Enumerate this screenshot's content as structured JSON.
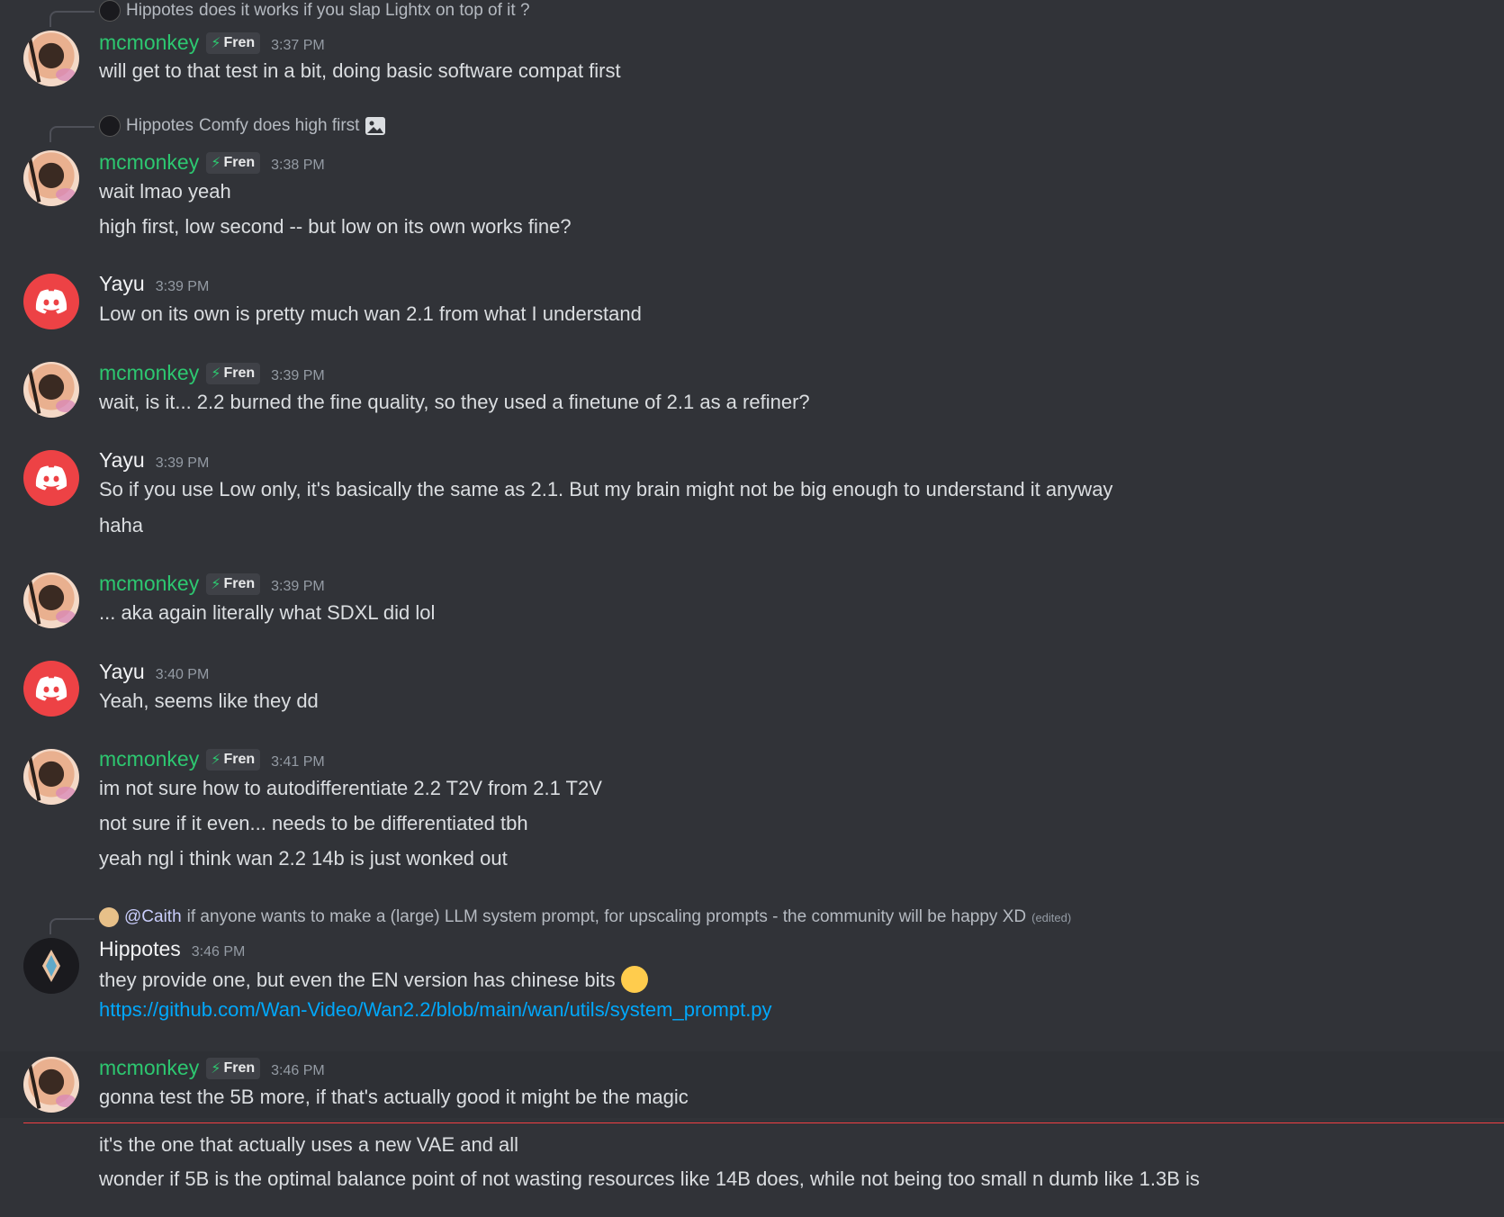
{
  "users": {
    "mcmonkey": {
      "name": "mcmonkey",
      "tag": "Fren"
    },
    "yayu": {
      "name": "Yayu"
    },
    "hippotes": {
      "name": "Hippotes"
    }
  },
  "colors": {
    "mcmonkey_name": "#2dc770",
    "link": "#00a8fc",
    "new_divider": "#f23f43"
  },
  "messages": [
    {
      "reply_user": "Hippotes",
      "reply_text": "does it works if you slap Lightx on top of it ?",
      "time": "3:37 PM",
      "lines": [
        "will get to that test in a bit, doing basic software compat first"
      ]
    },
    {
      "reply_user": "Hippotes",
      "reply_text": "Comfy does high first",
      "reply_icon": "image-icon",
      "time": "3:38 PM",
      "lines": [
        "wait lmao yeah",
        "high first, low second -- but low on its own works fine?"
      ]
    },
    {
      "time": "3:39 PM",
      "lines": [
        "Low on its own is pretty much wan 2.1 from what I understand"
      ]
    },
    {
      "time": "3:39 PM",
      "lines": [
        "wait, is it... 2.2 burned the fine quality, so they used a finetune of 2.1 as a refiner?"
      ]
    },
    {
      "time": "3:39 PM",
      "lines": [
        "So if you use Low only, it's basically the same as 2.1. But my brain might not be big enough to understand it anyway",
        "haha"
      ]
    },
    {
      "time": "3:39 PM",
      "lines": [
        "... aka again literally what SDXL did lol"
      ]
    },
    {
      "time": "3:40 PM",
      "lines": [
        "Yeah, seems like they dd"
      ]
    },
    {
      "time": "3:41 PM",
      "lines": [
        "im not sure how to autodifferentiate 2.2 T2V from 2.1 T2V",
        "not sure if it even... needs to be differentiated tbh",
        "yeah ngl i think wan 2.2 14b is just wonked out"
      ]
    },
    {
      "reply_user": "@Caith",
      "reply_text": "if anyone wants to make a (large) LLM system prompt, for upscaling prompts - the community will be happy XD",
      "reply_edited": "(edited)",
      "time": "3:46 PM",
      "lines": [
        "they provide one, but even the EN version has chinese bits"
      ],
      "link": "https://github.com/Wan-Video/Wan2.2/blob/main/wan/utils/system_prompt.py"
    },
    {
      "time": "3:46 PM",
      "lines": [
        "gonna test the 5B more, if that's actually good it might be the magic",
        "it's the one that actually uses a new VAE and all",
        "wonder if 5B is the optimal balance point of not wasting resources like 14B does, while not being too small n dumb like 1.3B is"
      ]
    }
  ]
}
